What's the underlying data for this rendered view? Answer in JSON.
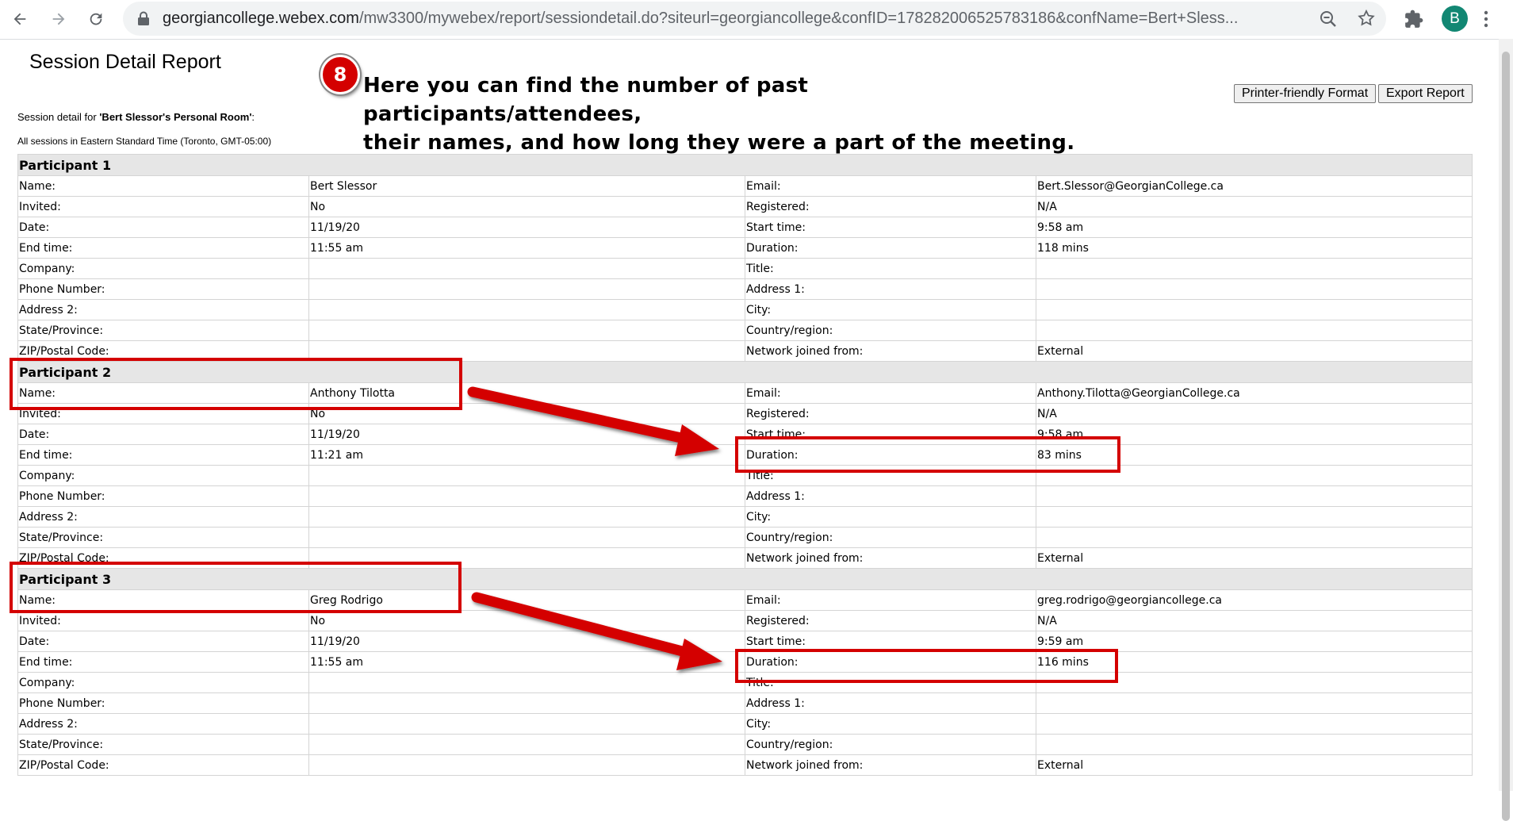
{
  "browser": {
    "url_host": "georgiancollege.webex.com",
    "url_path": "/mw3300/mywebex/report/sessiondetail.do?siteurl=georgiancollege&confID=178282006525783186&confName=Bert+Sless...",
    "profile_initial": "B"
  },
  "page": {
    "title": "Session Detail Report",
    "session_for_prefix": "Session detail for ",
    "session_name": "'Bert Slessor's Personal Room'",
    "session_for_suffix": ":",
    "timezone_note": "All sessions in Eastern Standard Time (Toronto, GMT-05:00)",
    "printer_button": "Printer-friendly Format",
    "export_button": "Export Report"
  },
  "callout": {
    "number": "8",
    "line1": "Here you can find the number of past participants/attendees,",
    "line2": "their names, and how long they were a part of the meeting."
  },
  "labels": {
    "left": [
      "Name:",
      "Invited:",
      "Date:",
      "End time:",
      "Company:",
      "Phone Number:",
      "Address 2:",
      "State/Province:",
      "ZIP/Postal Code:"
    ],
    "right": [
      "Email:",
      "Registered:",
      "Start time:",
      "Duration:",
      "Title:",
      "Address 1:",
      "City:",
      "Country/region:",
      "Network joined from:"
    ]
  },
  "participants": [
    {
      "heading": "Participant 1",
      "left": [
        "Bert Slessor",
        "No",
        "11/19/20",
        "11:55 am",
        "",
        "",
        "",
        "",
        ""
      ],
      "right": [
        "Bert.Slessor@GeorgianCollege.ca",
        "N/A",
        "9:58 am",
        "118 mins",
        "",
        "",
        "",
        "",
        "External"
      ]
    },
    {
      "heading": "Participant 2",
      "left": [
        "Anthony Tilotta",
        "No",
        "11/19/20",
        "11:21 am",
        "",
        "",
        "",
        "",
        ""
      ],
      "right": [
        "Anthony.Tilotta@GeorgianCollege.ca",
        "N/A",
        "9:58 am",
        "83 mins",
        "",
        "",
        "",
        "",
        "External"
      ]
    },
    {
      "heading": "Participant 3",
      "left": [
        "Greg Rodrigo",
        "No",
        "11/19/20",
        "11:55 am",
        "",
        "",
        "",
        "",
        ""
      ],
      "right": [
        "greg.rodrigo@georgiancollege.ca",
        "N/A",
        "9:59 am",
        "116 mins",
        "",
        "",
        "",
        "",
        "External"
      ]
    }
  ]
}
